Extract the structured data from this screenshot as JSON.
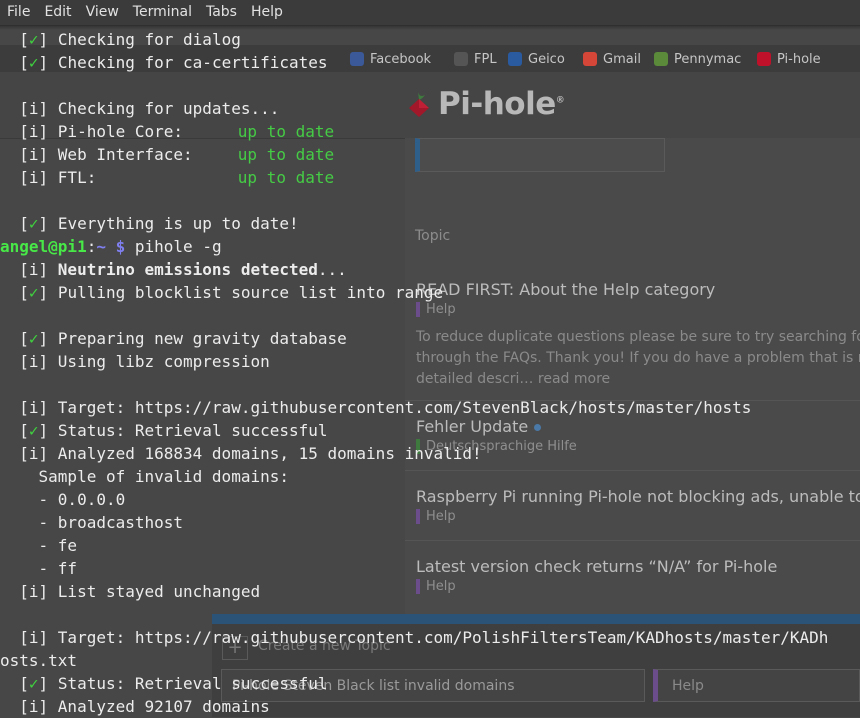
{
  "menubar": [
    "File",
    "Edit",
    "View",
    "Terminal",
    "Tabs",
    "Help"
  ],
  "background_browser": {
    "bookmarks": [
      {
        "label": "Facebook",
        "icon": "facebook-icon",
        "color": "#3b5998"
      },
      {
        "label": "FPL",
        "icon": "fpl-icon",
        "color": "#555555"
      },
      {
        "label": "Geico",
        "icon": "geico-icon",
        "color": "#2a5aa0"
      },
      {
        "label": "Gmail",
        "icon": "gmail-icon",
        "color": "#d44638"
      },
      {
        "label": "Pennymac",
        "icon": "pennymac-icon",
        "color": "#5a8a3a"
      },
      {
        "label": "Pi-hole",
        "icon": "pihole-icon",
        "color": "#c0112a"
      }
    ],
    "logo_text": "Pi-hole",
    "logo_mark": "®",
    "column_header": "Topic",
    "topics": [
      {
        "title": "READ FIRST: About the Help category",
        "category": "Help",
        "excerpt": [
          "To reduce duplicate questions please be sure to try searching for a",
          "through the FAQs. Thank you! If you do have a problem that is not s",
          "detailed descri… read more"
        ]
      },
      {
        "title": "Fehler Update",
        "category": "Deutschsprachige Hilfe",
        "excerpt": []
      },
      {
        "title": "Raspberry Pi running Pi-hole not blocking ads, unable to p",
        "category": "Help",
        "excerpt": []
      },
      {
        "title": "Latest version check returns “N/A” for Pi-hole",
        "category": "Help",
        "excerpt": []
      }
    ],
    "composer": {
      "label": "Create a new Topic",
      "title_value": "Pi-hole Steven Black list invalid domains",
      "category_value": "Help"
    }
  },
  "terminal": {
    "colors": {
      "check": "#3fd43f",
      "prompt_user": "#47e847",
      "prompt_path": "#7f7ff0"
    },
    "lines": [
      {
        "t": "check",
        "text": "Checking for dialog"
      },
      {
        "t": "check",
        "text": "Checking for ca-certificates"
      },
      {
        "t": "blank"
      },
      {
        "t": "info",
        "text": "Checking for updates..."
      },
      {
        "t": "status",
        "label": "Pi-hole Core:",
        "value": "up to date"
      },
      {
        "t": "status",
        "label": "Web Interface:",
        "value": "up to date"
      },
      {
        "t": "status",
        "label": "FTL:",
        "value": "up to date"
      },
      {
        "t": "blank"
      },
      {
        "t": "check",
        "text": "Everything is up to date!"
      },
      {
        "t": "prompt",
        "user": "angel@pi1",
        "path": "~",
        "cmd": "pihole -g"
      },
      {
        "t": "info",
        "bold": "Neutrino emissions detected",
        "text": "..."
      },
      {
        "t": "check",
        "text": "Pulling blocklist source list into range"
      },
      {
        "t": "blank"
      },
      {
        "t": "check",
        "text": "Preparing new gravity database"
      },
      {
        "t": "info",
        "text": "Using libz compression"
      },
      {
        "t": "blank"
      },
      {
        "t": "info",
        "text": "Target: https://raw.githubusercontent.com/StevenBlack/hosts/master/hosts"
      },
      {
        "t": "check",
        "text": "Status: Retrieval successful"
      },
      {
        "t": "info",
        "text": "Analyzed 168834 domains, 15 domains invalid!"
      },
      {
        "t": "plain",
        "text": "    Sample of invalid domains:"
      },
      {
        "t": "plain",
        "text": "    - 0.0.0.0"
      },
      {
        "t": "plain",
        "text": "    - broadcasthost"
      },
      {
        "t": "plain",
        "text": "    - fe"
      },
      {
        "t": "plain",
        "text": "    - ff"
      },
      {
        "t": "info",
        "text": "List stayed unchanged"
      },
      {
        "t": "blank"
      },
      {
        "t": "info",
        "text": "Target: https://raw.githubusercontent.com/PolishFiltersTeam/KADhosts/master/KADh"
      },
      {
        "t": "raw",
        "text": "osts.txt"
      },
      {
        "t": "check",
        "text": "Status: Retrieval successful"
      },
      {
        "t": "info",
        "text": "Analyzed 92107 domains"
      }
    ]
  }
}
